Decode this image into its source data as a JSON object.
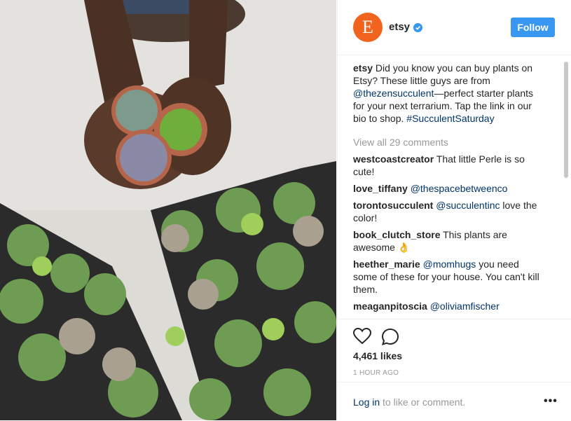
{
  "post": {
    "username": "etsy",
    "avatar_letter": "E",
    "follow_label": "Follow",
    "caption_user": "etsy",
    "caption_text_1": "Did you know you can buy plants on Etsy? These little guys are from ",
    "caption_mention": "@thezensucculent",
    "caption_text_2": "—perfect starter plants for your next terrarium. Tap the link in our bio to shop. ",
    "caption_hashtag": "#SucculentSaturday",
    "view_all": "View all 29 comments",
    "comments": [
      {
        "user": "westcoastcreator",
        "mention": "",
        "text": "That little Perle is so cute!"
      },
      {
        "user": "love_tiffany",
        "mention": "@thespacebetweenco",
        "text": ""
      },
      {
        "user": "torontosucculent",
        "mention": "@succulentinc",
        "text": "love the color!"
      },
      {
        "user": "book_clutch_store",
        "mention": "",
        "text": "This plants are awesome 👌"
      },
      {
        "user": "heether_marie",
        "mention": "@momhugs",
        "text": "you need some of these for your house. You can't kill them."
      },
      {
        "user": "meaganpitoscia",
        "mention": "@oliviamfischer",
        "text": ""
      }
    ],
    "likes": "4,461 likes",
    "time": "1 HOUR AGO",
    "login_link": "Log in",
    "login_text": " to like or comment.",
    "more_label": "•••",
    "colors": {
      "accent": "#3897f0",
      "brand": "#f1641e",
      "link": "#003569"
    }
  }
}
